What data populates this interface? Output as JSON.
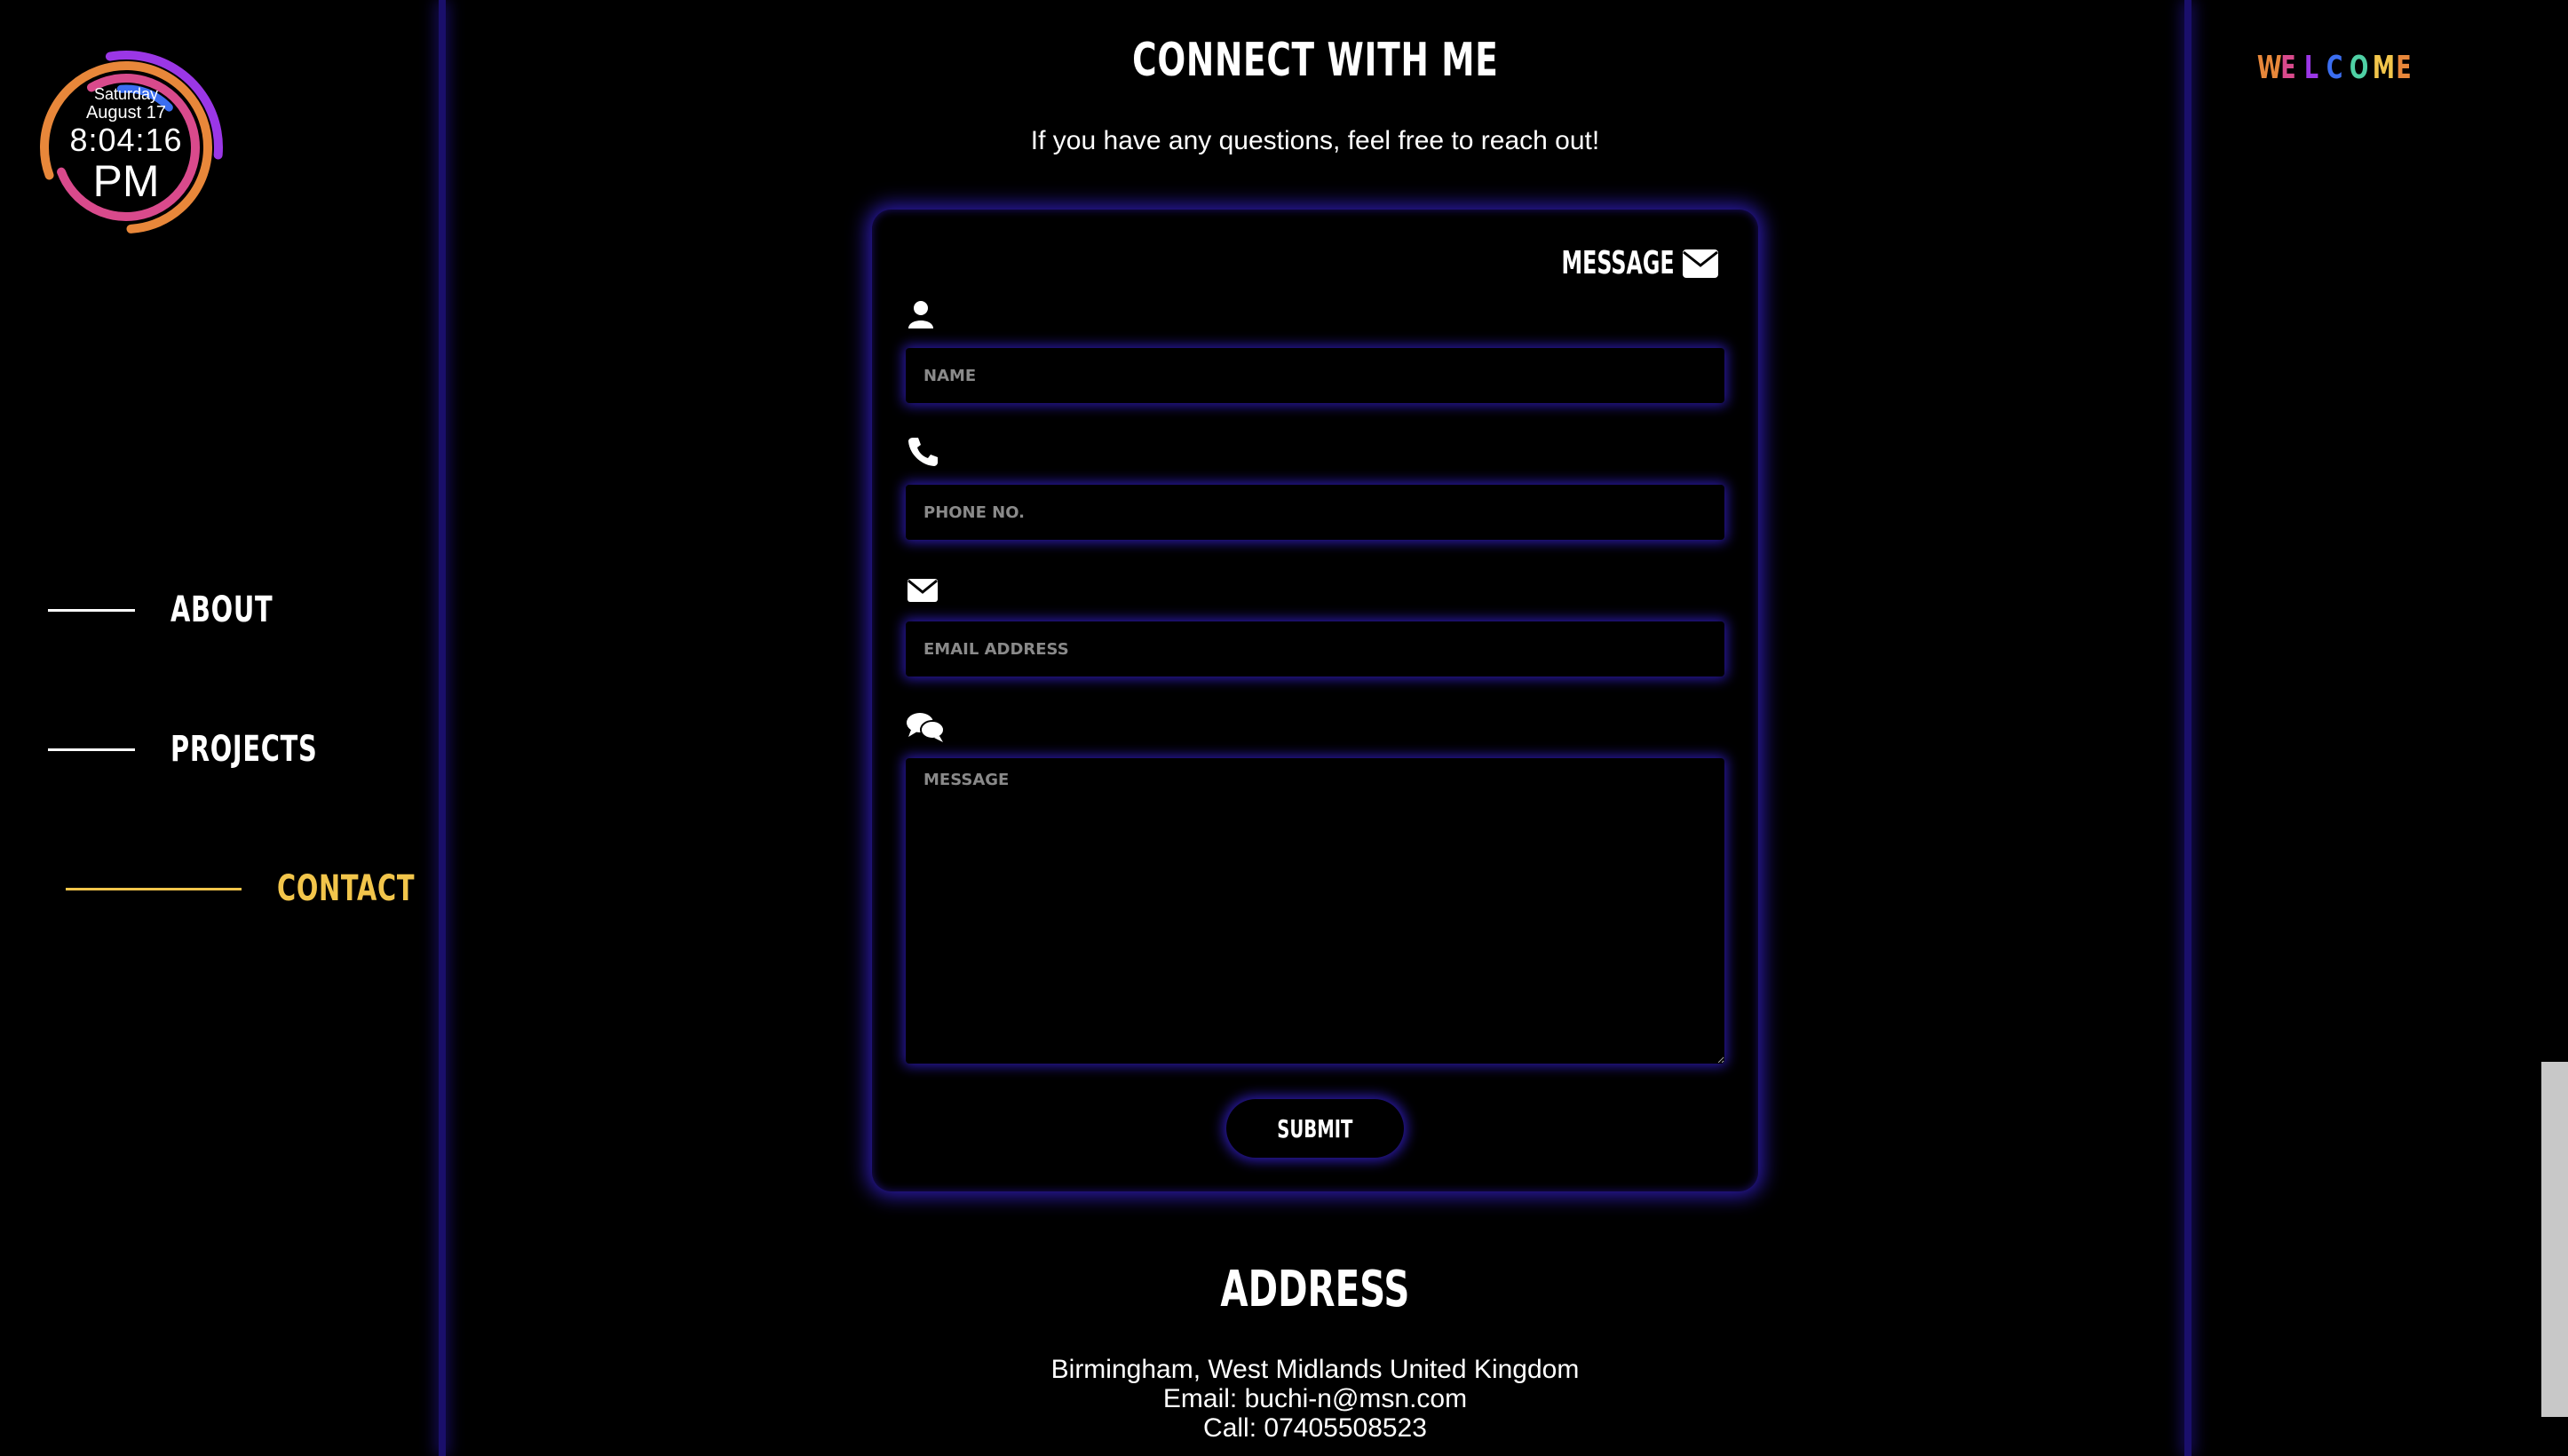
{
  "clock": {
    "day": "Saturday",
    "date": "August 17",
    "time": "8:04:16",
    "ampm": "PM",
    "ring_colors": [
      "#e8873a",
      "#d94a8c",
      "#9b37e6",
      "#3b6ef0",
      "#f2c54b"
    ]
  },
  "nav": {
    "items": [
      {
        "label": "ABOUT",
        "active": false
      },
      {
        "label": "PROJECTS",
        "active": false
      },
      {
        "label": "CONTACT",
        "active": true
      }
    ],
    "active_color": "#f2c54b"
  },
  "contact": {
    "title": "CONNECT WITH ME",
    "subtitle": "If you have any questions, feel free to reach out!",
    "form": {
      "header_label": "MESSAGE",
      "header_icon": "envelope-icon",
      "fields": [
        {
          "icon": "user-icon",
          "placeholder": "NAME",
          "value": ""
        },
        {
          "icon": "phone-icon",
          "placeholder": "PHONE NO.",
          "value": ""
        },
        {
          "icon": "envelope-icon",
          "placeholder": "EMAIL ADDRESS",
          "value": ""
        },
        {
          "icon": "comments-icon",
          "placeholder": "MESSAGE",
          "value": ""
        }
      ],
      "submit_label": "SUBMIT"
    },
    "glow_color": "#2b1aa8"
  },
  "address": {
    "title": "ADDRESS",
    "lines": [
      "Birmingham, West Midlands United Kingdom",
      "Email: buchi-n@msn.com",
      "Call: 07405508523"
    ]
  },
  "welcome": {
    "letters": [
      "W",
      "E",
      "L",
      "C",
      "O",
      "M",
      "E"
    ],
    "colors": [
      "#e8873a",
      "#d94a8c",
      "#9b37e6",
      "#3b6ef0",
      "#4fd1a5",
      "#f2c54b",
      "#e8873a"
    ]
  }
}
